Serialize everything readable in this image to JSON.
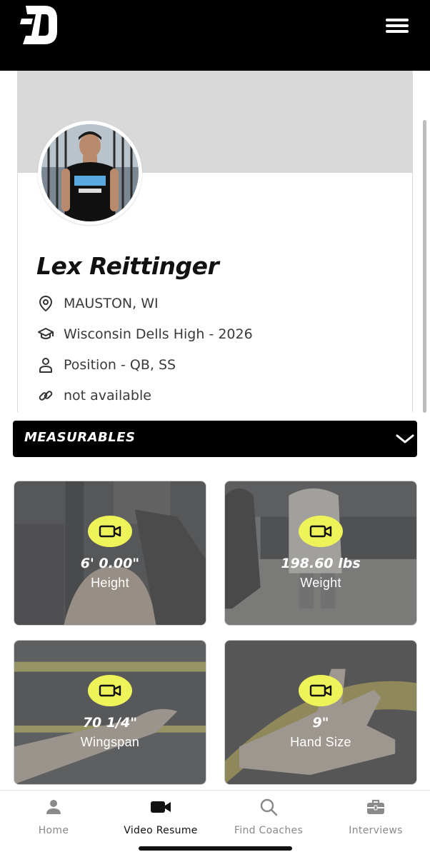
{
  "header": {
    "menu_icon": "hamburger-menu-icon",
    "logo_icon": "d-logo-icon"
  },
  "profile": {
    "name": "Lex Reittinger",
    "location": "MAUSTON, WI",
    "school": "Wisconsin Dells High - 2026",
    "position": "Position - QB, SS",
    "link": "not available",
    "icons": [
      "location-pin-icon",
      "graduation-cap-icon",
      "person-icon",
      "link-icon"
    ]
  },
  "measurables": {
    "title": "MEASURABLES",
    "cards": [
      {
        "value": "6' 0.00\"",
        "label": "Height"
      },
      {
        "value": "198.60 lbs",
        "label": "Weight"
      },
      {
        "value": "70 1/4\"",
        "label": "Wingspan"
      },
      {
        "value": "9\"",
        "label": "Hand Size"
      }
    ]
  },
  "nav": {
    "items": [
      {
        "label": "Home",
        "icon": "person-icon"
      },
      {
        "label": "Video Resume",
        "icon": "video-camera-icon"
      },
      {
        "label": "Find Coaches",
        "icon": "search-icon"
      },
      {
        "label": "Interviews",
        "icon": "briefcase-icon"
      }
    ],
    "active": "Video Resume"
  },
  "colors": {
    "accent": "#eef35a",
    "bar": "#000000",
    "cover": "#d9d9d9"
  }
}
